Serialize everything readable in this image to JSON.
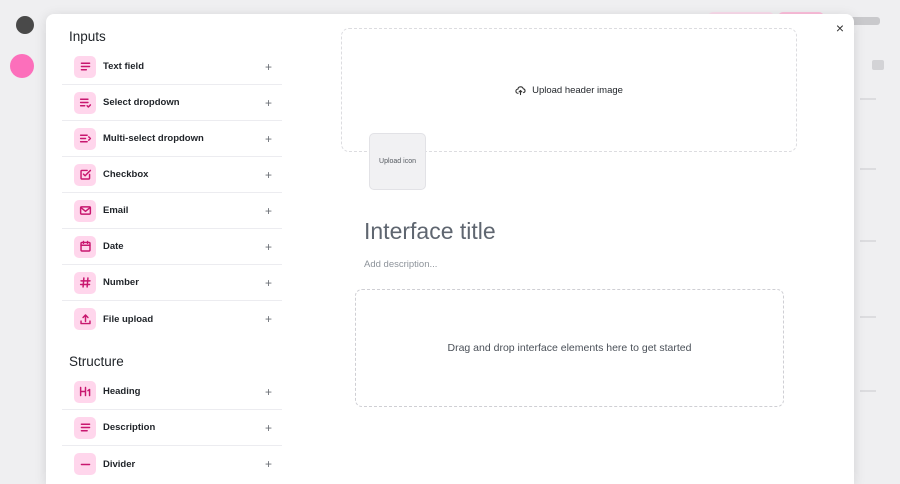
{
  "modal": {
    "close_label": "×"
  },
  "palette": {
    "sections": [
      {
        "title": "Inputs",
        "items": [
          {
            "label": "Text field",
            "icon": "text-lines-icon"
          },
          {
            "label": "Select dropdown",
            "icon": "list-check-icon"
          },
          {
            "label": "Multi-select dropdown",
            "icon": "list-multi-icon"
          },
          {
            "label": "Checkbox",
            "icon": "checkbox-icon"
          },
          {
            "label": "Email",
            "icon": "mail-icon"
          },
          {
            "label": "Date",
            "icon": "calendar-icon"
          },
          {
            "label": "Number",
            "icon": "hash-icon"
          },
          {
            "label": "File upload",
            "icon": "upload-icon"
          }
        ]
      },
      {
        "title": "Structure",
        "items": [
          {
            "label": "Heading",
            "icon": "heading-icon"
          },
          {
            "label": "Description",
            "icon": "paragraph-icon"
          },
          {
            "label": "Divider",
            "icon": "divider-icon"
          }
        ]
      }
    ],
    "add_glyph": "+"
  },
  "canvas": {
    "upload_header_label": "Upload header image",
    "upload_icon_label": "Upload icon",
    "title": "Interface title",
    "description_placeholder": "Add description...",
    "drop_zone_text": "Drag and drop interface elements here to get started"
  },
  "colors": {
    "accent": "#c8176f",
    "accent_bg": "#ffd6ec"
  }
}
